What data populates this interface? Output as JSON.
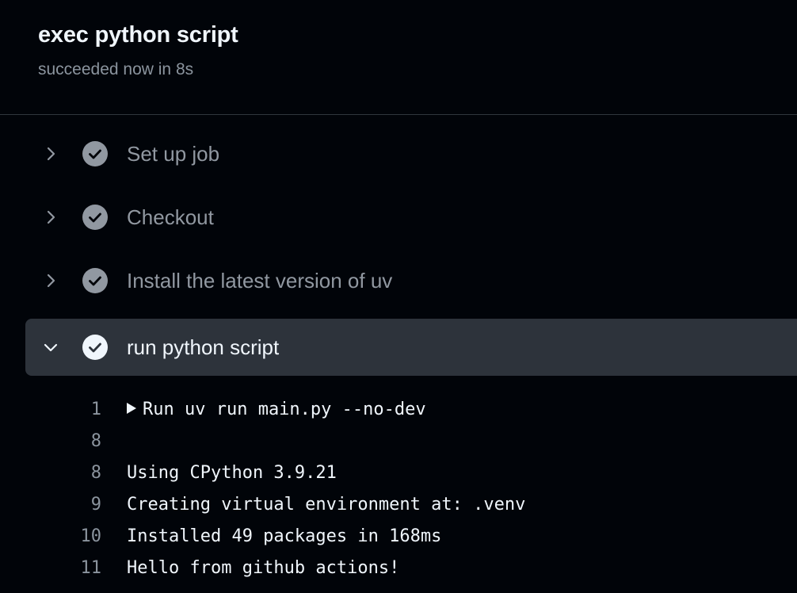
{
  "job": {
    "title": "exec python script",
    "status": "succeeded now in 8s"
  },
  "steps": [
    {
      "label": "Set up job",
      "state": "collapsed",
      "icon": "check-circle-icon"
    },
    {
      "label": "Checkout",
      "state": "collapsed",
      "icon": "check-circle-icon"
    },
    {
      "label": "Install the latest version of uv",
      "state": "collapsed",
      "icon": "check-circle-icon"
    },
    {
      "label": "run python script",
      "state": "expanded",
      "icon": "check-circle-icon"
    }
  ],
  "log": [
    {
      "no": "1",
      "text": "Run uv run main.py --no-dev",
      "group": true
    },
    {
      "no": "8",
      "text": ""
    },
    {
      "no": "8",
      "text": "Using CPython 3.9.21"
    },
    {
      "no": "9",
      "text": "Creating virtual environment at: .venv"
    },
    {
      "no": "10",
      "text": "Installed 49 packages in 168ms"
    },
    {
      "no": "11",
      "text": "Hello from github actions!"
    }
  ],
  "colors": {
    "background": "#010409",
    "expanded_row": "#2d333b",
    "muted_text": "#9198a1"
  }
}
